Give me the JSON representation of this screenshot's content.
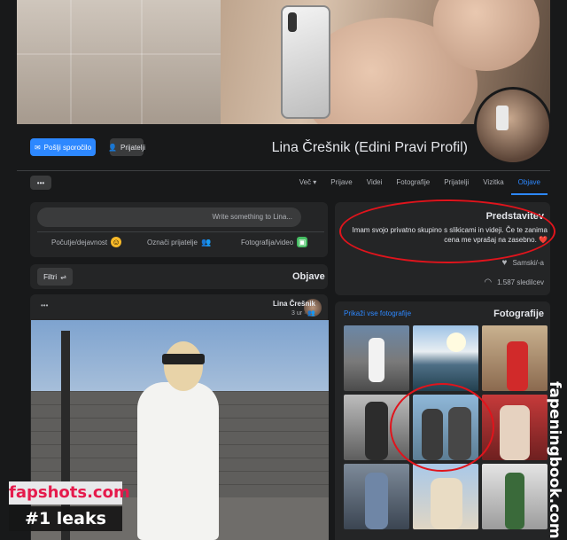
{
  "profile": {
    "name": "Lina Črešnik (Edini Pravi Profil)",
    "send_message": "Pošlji sporočilo",
    "friends_button": "Prijatelji",
    "more_button": "•••"
  },
  "tabs": [
    {
      "label": "Objave",
      "active": true
    },
    {
      "label": "Vizitka"
    },
    {
      "label": "Prijatelji"
    },
    {
      "label": "Fotografije"
    },
    {
      "label": "Videi"
    },
    {
      "label": "Prijave"
    },
    {
      "label": "Več ▾"
    }
  ],
  "composer": {
    "placeholder": "Write something to Lina...",
    "actions": [
      {
        "label": "Fotografija/video",
        "icon": "photo-icon",
        "color": "#45bd62"
      },
      {
        "label": "Označi prijatelje",
        "icon": "tag-friends-icon",
        "color": "#1877f2"
      },
      {
        "label": "Počutje/dejavnost",
        "icon": "feeling-icon",
        "color": "#f7b928"
      }
    ]
  },
  "posts_section": {
    "title": "Objave",
    "filter": "Filtri"
  },
  "post": {
    "author": "Lina Črešnik",
    "meta": "3 ur · 👥",
    "more": "•••"
  },
  "intro": {
    "title": "Predstavitev",
    "bio": "Imam svojo privatno skupino s slikicami in videji. Če te zanima cena me vprašaj na zasebno. ❤️",
    "items": [
      {
        "icon": "heart-icon",
        "text": "Samski/-a"
      },
      {
        "icon": "follow-icon",
        "text": "1.587 sledilcev"
      }
    ]
  },
  "photos": {
    "title": "Fotografije",
    "see_all": "Prikaži vse fotografije"
  },
  "watermark": {
    "site": "fapshots.com",
    "tag": "#1 leaks",
    "side": "fapeningbook.com"
  },
  "colors": {
    "accent": "#2d88ff",
    "highlight": "#e0141c"
  }
}
